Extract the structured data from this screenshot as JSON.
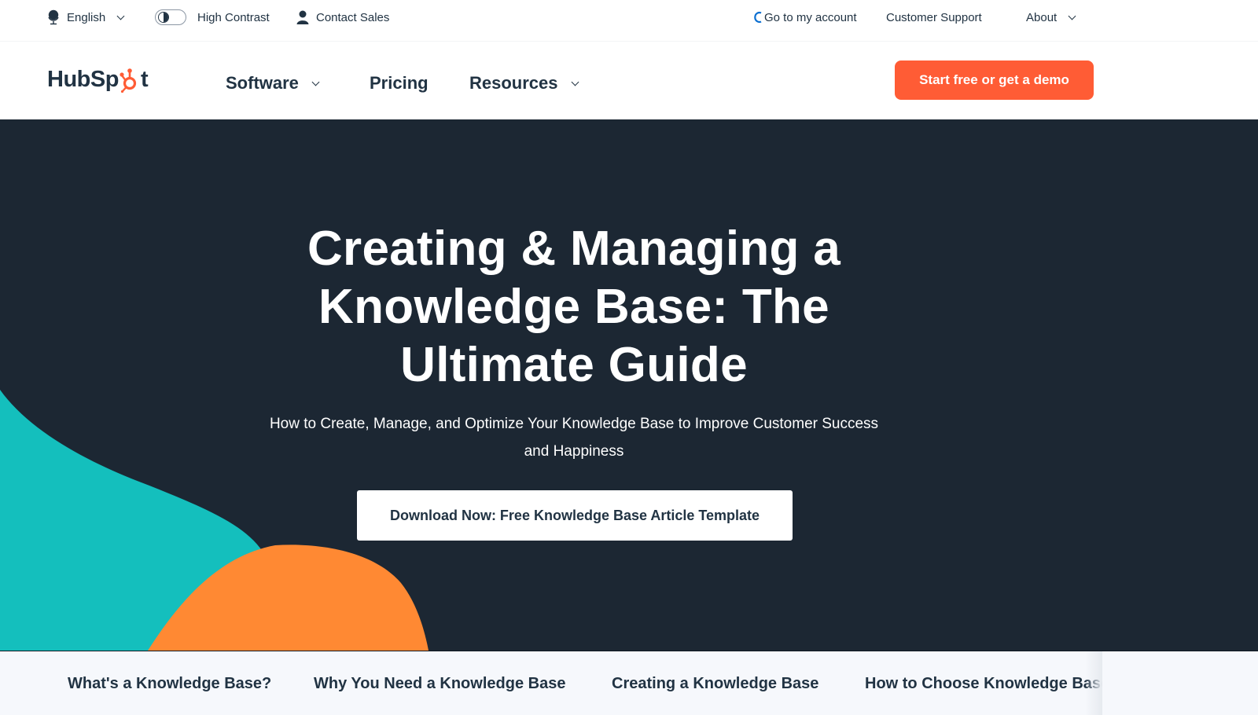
{
  "utility_bar": {
    "language": {
      "label": "English",
      "icon": "globe-icon"
    },
    "high_contrast": {
      "label": "High Contrast",
      "icon": "contrast-toggle",
      "enabled": false
    },
    "contact_sales": {
      "label": "Contact Sales",
      "icon": "person-icon"
    },
    "account": {
      "label": "Go to my account",
      "icon": "loading-spinner-icon"
    },
    "customer_support": {
      "label": "Customer Support"
    },
    "about": {
      "label": "About"
    }
  },
  "main_nav": {
    "logo": {
      "text_before": "HubSp",
      "text_after": "t",
      "brand_color": "#ff5c35"
    },
    "links": [
      {
        "label": "Software",
        "has_dropdown": true
      },
      {
        "label": "Pricing",
        "has_dropdown": false
      },
      {
        "label": "Resources",
        "has_dropdown": true
      }
    ],
    "cta": {
      "label": "Start free or get a demo",
      "color": "#ff5c35"
    }
  },
  "hero": {
    "title_lines": [
      "Creating & Managing a",
      "Knowledge Base: The",
      "Ultimate Guide"
    ],
    "subtitle_lines": [
      "How to Create, Manage, and Optimize Your Knowledge Base to Improve Customer Success",
      "and Happiness"
    ],
    "button": {
      "label": "Download Now: Free Knowledge Base Article Template"
    },
    "colors": {
      "background": "#1c2733",
      "teal_blob": "#14bfbd",
      "orange_blob": "#ff8933"
    }
  },
  "toc": {
    "items": [
      {
        "label": "What's a Knowledge Base?"
      },
      {
        "label": "Why You Need a Knowledge Base"
      },
      {
        "label": "Creating a Knowledge Base"
      },
      {
        "label": "How to Choose Knowledge Base"
      }
    ]
  }
}
